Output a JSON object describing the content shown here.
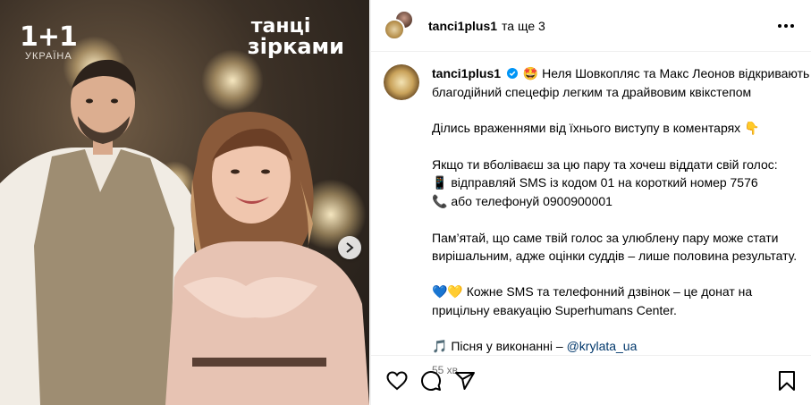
{
  "post_image": {
    "brand_logo": "1+1",
    "brand_sub": "УКРАЇНА",
    "show_logo_line1": "танці",
    "show_logo_line2": "зірками"
  },
  "header": {
    "username": "tanci1plus1",
    "coauthors": "та ще 3"
  },
  "caption": {
    "username": "tanci1plus1",
    "emoji_star_eyes": "🤩",
    "line1": "Неля Шовкопляс та Макс Леонов відкривають",
    "line2": "благодійний спецефір легким та драйвовим квікстепом",
    "line3": "Ділись враженнями від їхнього виступу в коментарях",
    "emoji_point": "👇",
    "line4": "Якщо ти вболіваєш за цю пару та хочеш віддати свій голос:",
    "emoji_phone": "📱",
    "line5": "відправляй SMS із кодом 01 на короткий номер 7576",
    "emoji_telephone": "📞",
    "line6": "або телефонуй 0900900001",
    "line7": "Пам’ятай, що саме твій голос за улюблену пару може стати",
    "line8": "вирішальним, адже оцінки суддів – лише половина результату.",
    "emoji_hearts": "💙💛",
    "line9": "Кожне SMS та телефонний дзвінок – це донат на",
    "line10": "прицільну евакуацію Superhumans Center.",
    "emoji_music": "🎵",
    "line11": "Пісня у виконанні –",
    "mention": "@krylata_ua",
    "time": "55 хв"
  },
  "colors": {
    "mention": "#00376b",
    "verified": "#0095f6",
    "muted": "#737373",
    "heart_blue": "#3897f0",
    "heart_yellow": "#f7d633"
  },
  "icons": [
    "more-icon",
    "like-icon",
    "comment-icon",
    "share-icon",
    "save-icon",
    "next-arrow-icon",
    "verified-icon"
  ]
}
